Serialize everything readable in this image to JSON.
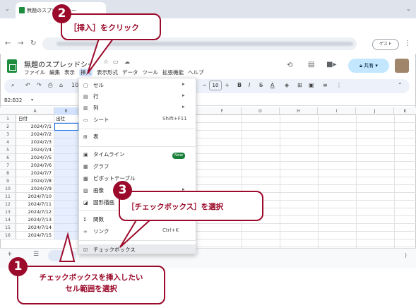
{
  "browser": {
    "tab_title": "無題のスプレッドシー",
    "guest_label": "ゲスト"
  },
  "doc": {
    "title": "無題のスプレッドシー",
    "menus": [
      "ファイル",
      "編集",
      "表示",
      "挿入",
      "表示形式",
      "データ",
      "ツール",
      "拡張機能",
      "ヘルプ"
    ],
    "share_label": "共有"
  },
  "toolbar": {
    "zoom": "100",
    "font_size": "10",
    "bold": "B",
    "italic": "I",
    "strike": "S",
    "textcolor": "A"
  },
  "namebox": "B2:B32",
  "columns": [
    "A",
    "B",
    "F",
    "G",
    "H",
    "I",
    "J",
    "K"
  ],
  "header_row": {
    "a": "日付",
    "b": "出社"
  },
  "rows": [
    {
      "n": "1",
      "date": ""
    },
    {
      "n": "2",
      "date": "2024/7/1"
    },
    {
      "n": "3",
      "date": "2024/7/2"
    },
    {
      "n": "4",
      "date": "2024/7/3"
    },
    {
      "n": "5",
      "date": "2024/7/4"
    },
    {
      "n": "6",
      "date": "2024/7/5"
    },
    {
      "n": "7",
      "date": "2024/7/6"
    },
    {
      "n": "8",
      "date": "2024/7/7"
    },
    {
      "n": "9",
      "date": "2024/7/8"
    },
    {
      "n": "10",
      "date": "2024/7/9"
    },
    {
      "n": "11",
      "date": "2024/7/10"
    },
    {
      "n": "12",
      "date": "2024/7/11"
    },
    {
      "n": "13",
      "date": "2024/7/12"
    },
    {
      "n": "14",
      "date": "2024/7/13"
    },
    {
      "n": "15",
      "date": "2024/7/14"
    },
    {
      "n": "16",
      "date": "2024/7/15"
    }
  ],
  "insert_menu": {
    "items": [
      {
        "label": "セル",
        "right": "▸"
      },
      {
        "label": "行",
        "right": "▸"
      },
      {
        "label": "列",
        "right": "▸"
      },
      {
        "label": "シート",
        "right": "Shift+F11"
      },
      {
        "label": "表",
        "right": ""
      },
      {
        "label": "タイムライン",
        "right": ""
      },
      {
        "label": "グラフ",
        "right": ""
      },
      {
        "label": "ピボットテーブル",
        "right": ""
      },
      {
        "label": "画像",
        "right": "▸"
      },
      {
        "label": "図形描画",
        "right": ""
      },
      {
        "label": "関数",
        "right": ""
      },
      {
        "label": "リンク",
        "right": "Ctrl+K"
      },
      {
        "label": "チェックボックス",
        "right": ""
      }
    ],
    "new_badge": "New"
  },
  "callouts": {
    "c1_num": "1",
    "c1_text": "チェックボックスを挿入したい\nセル範囲を選択",
    "c2_num": "2",
    "c2_text": "［挿入］をクリック",
    "c3_num": "3",
    "c3_text": "［チェックボックス］を選択"
  },
  "colors": {
    "accent": "#9b0a2a",
    "selection": "#e7efff",
    "share": "#c2e7ff"
  }
}
